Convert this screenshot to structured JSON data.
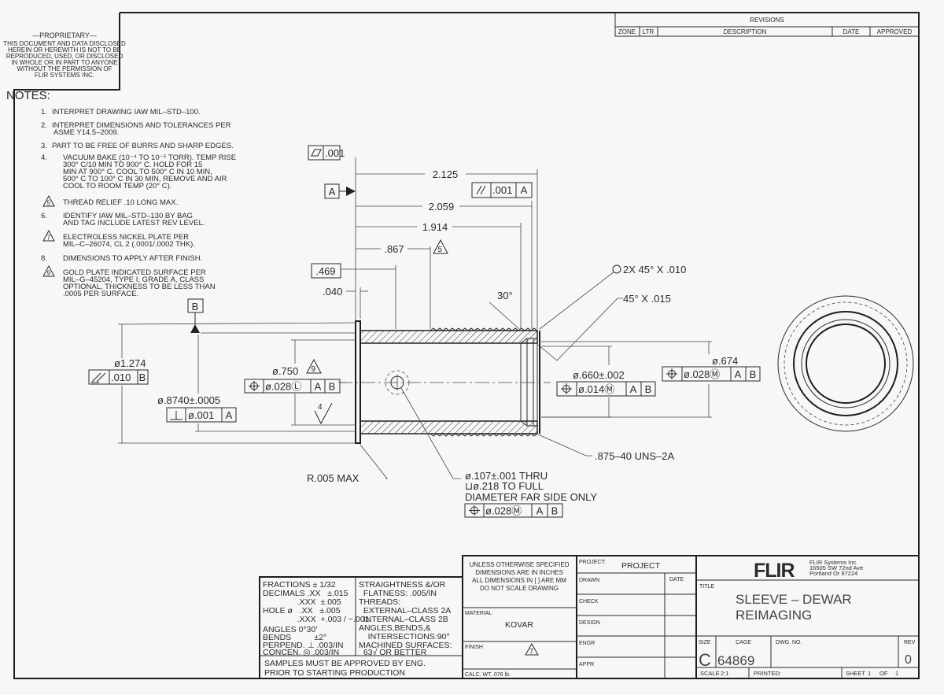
{
  "proprietary": {
    "heading": "—PROPRIETARY—",
    "lines": [
      "THIS DOCUMENT AND DATA DISCLOSED",
      "HEREIN OR HEREWITH IS NOT TO BE",
      "REPRODUCED, USED, OR DISCLOSED",
      "IN WHOLE OR IN PART TO ANYONE",
      "WITHOUT THE PERMISSION OF",
      "FLIR SYSTEMS INC."
    ]
  },
  "notes": {
    "heading": "NOTES:",
    "items": [
      {
        "num": "1.",
        "lines": [
          "INTERPRET DRAWING IAW MIL–STD–100."
        ]
      },
      {
        "num": "2.",
        "lines": [
          "INTERPRET DIMENSIONS AND TOLERANCES PER",
          "ASME Y14.5–2009."
        ]
      },
      {
        "num": "3.",
        "lines": [
          "PART TO BE FREE OF BURRS AND SHARP EDGES."
        ]
      },
      {
        "num": "4.",
        "lines": [
          "VACUUM BAKE (10⁻⁴ TO 10⁻⁵ TORR). TEMP RISE",
          "300° C/10 MIN TO 900° C. HOLD FOR 15",
          "MIN AT 900° C. COOL TO 500° C IN 10 MIN,",
          "500° C TO 100° C IN 30 MIN, REMOVE AND AIR",
          "COOL TO ROOM TEMP (20° C)."
        ]
      },
      {
        "num": "5",
        "flag": true,
        "lines": [
          "THREAD RELIEF .10 LONG MAX."
        ]
      },
      {
        "num": "6.",
        "lines": [
          "IDENTIFY IAW MIL–STD–130 BY BAG",
          "AND TAG INCLUDE LATEST REV LEVEL."
        ]
      },
      {
        "num": "7",
        "flag": true,
        "lines": [
          "ELECTROLESS NICKEL PLATE PER",
          "MIL–C–26074, CL 2 (.0001/.0002 THK)."
        ]
      },
      {
        "num": "8.",
        "lines": [
          "DIMENSIONS TO APPLY AFTER FINISH."
        ]
      },
      {
        "num": "9",
        "flag": true,
        "lines": [
          "GOLD PLATE INDICATED SURFACE PER",
          "MIL–G–45204, TYPE I, GRADE A, CLASS",
          "OPTIONAL, THICKNESS TO BE LESS THAN",
          ".0005 PER SURFACE."
        ]
      }
    ]
  },
  "revisions": {
    "title": "REVISIONS",
    "columns": [
      "ZONE",
      "LTR",
      "DESCRIPTION",
      "DATE",
      "APPROVED"
    ]
  },
  "drawing": {
    "flatness": {
      "symbol": "flatness-icon",
      "value": ".001"
    },
    "datum_a": "A",
    "datum_b": "B",
    "dim_2125": "2.125",
    "parallelism": {
      "symbol": "parallelism-icon",
      "value": ".001",
      "datum": "A"
    },
    "dim_2059": "2.059",
    "dim_1914": "1.914",
    "dim_867": ".867",
    "flag_5": "5",
    "dim_469": ".469",
    "dim_040": ".040",
    "angle_30": "30°",
    "dia_1274": "ø1.274",
    "runout": {
      "symbol": "total-runout-icon",
      "value": ".010",
      "datum": "B"
    },
    "dia_8740": "ø.8740±.0005",
    "perpendicularity": {
      "symbol": "perpendicularity-icon",
      "value": "ø.001",
      "datum": "A"
    },
    "dia_750": "ø.750",
    "flag_9": "9",
    "position_750": {
      "symbol": "position-icon",
      "value": "ø.028Ⓛ",
      "datums": [
        "A",
        "B"
      ]
    },
    "surface_finish": "4",
    "radius": "R.005 MAX",
    "hole": {
      "lines": [
        "ø.107±.001 THRU",
        "⊔ø.218 TO FULL",
        "DIAMETER FAR SIDE ONLY"
      ],
      "position": {
        "symbol": "position-icon",
        "value": "ø.028Ⓜ",
        "datums": [
          "A",
          "B"
        ]
      }
    },
    "chamfer_1": "2X 45° X .010",
    "chamfer_2": "45° X .015",
    "dia_660": "ø.660±.002",
    "position_660": {
      "symbol": "position-icon",
      "value": "ø.014Ⓜ",
      "datums": [
        "A",
        "B"
      ]
    },
    "dia_674": "ø.674",
    "position_674": {
      "symbol": "position-icon",
      "value": "ø.028Ⓜ",
      "datums": [
        "A",
        "B"
      ]
    },
    "thread": ".875–40 UNS–2A"
  },
  "tolerances": {
    "left": [
      "FRACTIONS ± 1/32",
      "DECIMALS .XX   ±.015",
      "               .XXX  ±.005",
      "HOLE ø   .XX   ±.005",
      "               .XXX  +.003 / −.001",
      "ANGLES 0°30'",
      "BENDS          ±2°",
      "PERPEND. ⊥ .003/IN",
      "CONCEN. ◎ .003/IN"
    ],
    "right": [
      "STRAIGHTNESS &/OR",
      "  FLATNESS: .005/IN",
      "THREADS:",
      "  EXTERNAL–CLASS 2A",
      "  INTERNAL–CLASS 2B",
      "ANGLES,BENDS,&",
      "    INTERSECTIONS:90°",
      "MACHINED SURFACES:",
      "  63√ OR BETTER"
    ],
    "samples": [
      "SAMPLES MUST BE APPROVED BY ENG.",
      "PRIOR TO STARTING PRODUCTION"
    ]
  },
  "spec": {
    "unless": [
      "UNLESS OTHERWISE SPECIFIED",
      "DIMENSIONS ARE IN INCHES",
      "ALL DIMENSIONS IN [ ] ARE MM",
      "DO NOT SCALE DRAWING"
    ],
    "material_label": "MATERIAL",
    "material": "KOVAR",
    "finish_label": "FINISH",
    "finish_flag": "7",
    "calc_wt_label": "CALC. WT.",
    "calc_wt": ".076 lb."
  },
  "approvals": {
    "project_label": "PROJECT:",
    "project": "PROJECT",
    "date_label": "DATE",
    "rows": [
      "DRAWN",
      "CHECK",
      "DESIGN",
      "ENGR",
      "APPR"
    ]
  },
  "title_block": {
    "logo": "FLIR",
    "company": [
      "FLIR Systems Inc.",
      "16505 SW 72nd Ave",
      "Portland Or 97224"
    ],
    "title_label": "TITLE",
    "title": [
      "SLEEVE – DEWAR",
      "REIMAGING"
    ],
    "size_label": "SIZE",
    "size": "C",
    "cage_label": "CAGE",
    "cage": "64869",
    "dwg_label": "DWG. NO.",
    "rev_label": "REV",
    "rev": "0",
    "scale_label": "SCALE",
    "scale": "2:1",
    "printed_label": "PRINTED:",
    "sheet_label": "SHEET",
    "sheet": "1",
    "of_label": "OF",
    "sheet_total": "1"
  }
}
